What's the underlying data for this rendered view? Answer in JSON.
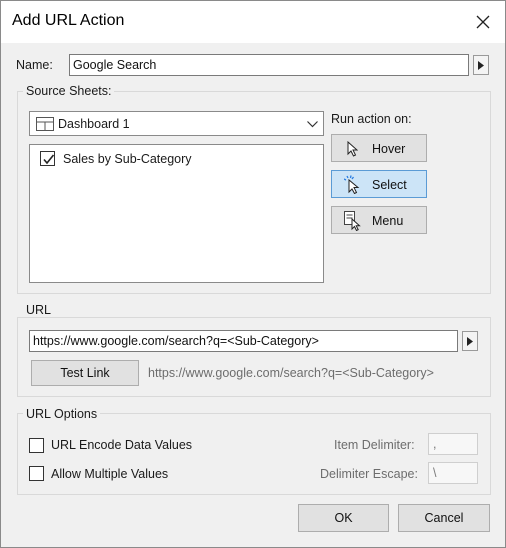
{
  "dialog": {
    "title": "Add URL Action",
    "close_icon": "close-icon"
  },
  "name": {
    "label": "Name:",
    "value": "Google Search"
  },
  "source_sheets": {
    "group_label": "Source Sheets:",
    "dashboard_selected": "Dashboard 1",
    "dashboard_icon": "dashboard-grid-icon",
    "sheets": [
      {
        "label": "Sales by Sub-Category",
        "checked": true
      }
    ]
  },
  "run_action": {
    "label": "Run action on:",
    "options": [
      {
        "label": "Hover",
        "icon": "pointer-arrow-icon",
        "selected": false
      },
      {
        "label": "Select",
        "icon": "pointer-click-icon",
        "selected": true
      },
      {
        "label": "Menu",
        "icon": "menu-pointer-icon",
        "selected": false
      }
    ]
  },
  "url": {
    "group_label": "URL",
    "value": "https://www.google.com/search?q=<Sub-Category>",
    "test_link_label": "Test Link",
    "preview": "https://www.google.com/search?q=<Sub-Category>"
  },
  "url_options": {
    "group_label": "URL Options",
    "encode_label": "URL Encode Data Values",
    "encode_checked": false,
    "multiple_label": "Allow Multiple Values",
    "multiple_checked": false,
    "item_delimiter_label": "Item Delimiter:",
    "item_delimiter_value": ",",
    "delimiter_escape_label": "Delimiter Escape:",
    "delimiter_escape_value": "\\"
  },
  "footer": {
    "ok_label": "OK",
    "cancel_label": "Cancel"
  },
  "colors": {
    "selected_button": "#cce4f7",
    "selected_border": "#5b9bd5",
    "dialog_bg": "#f0f0f0"
  }
}
